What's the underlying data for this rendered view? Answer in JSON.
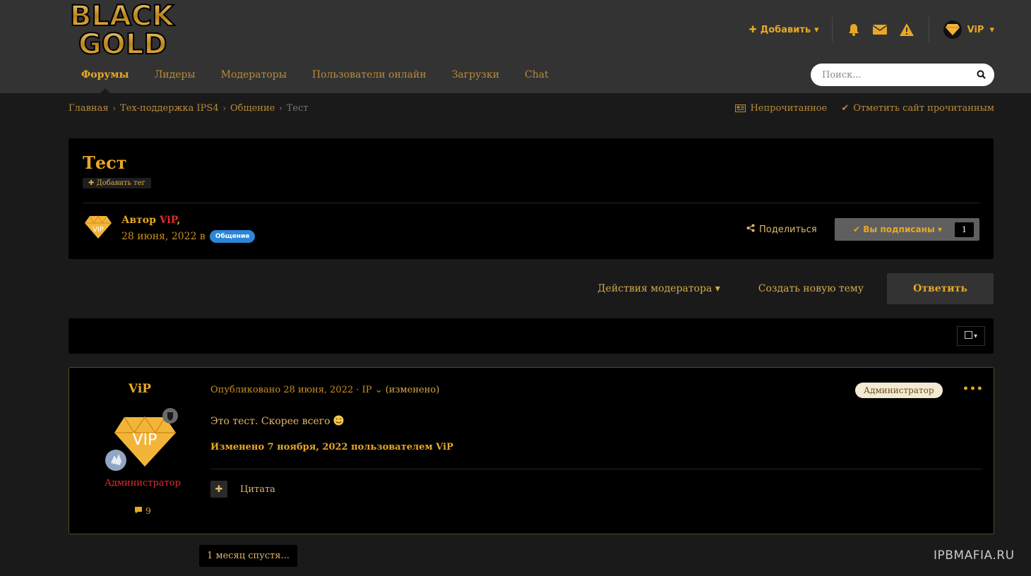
{
  "logo": {
    "line1": "BLACK",
    "line2": "GOLD"
  },
  "userbar": {
    "add_label": "Добавить",
    "icons": [
      "bell-icon",
      "envelope-icon",
      "warning-icon"
    ],
    "username": "ViP"
  },
  "nav": {
    "items": [
      {
        "label": "Форумы",
        "active": true
      },
      {
        "label": "Лидеры"
      },
      {
        "label": "Модераторы"
      },
      {
        "label": "Пользователи онлайн"
      },
      {
        "label": "Загрузки"
      },
      {
        "label": "Chat"
      }
    ],
    "search_placeholder": "Поиск..."
  },
  "breadcrumb": {
    "items": [
      "Главная",
      "Тех-поддержка IPS4",
      "Общение",
      "Тест"
    ],
    "unread": "Непрочитанное",
    "mark_read": "Отметить сайт прочитанным"
  },
  "topic": {
    "title": "Тест",
    "add_tag": "Добавить тег",
    "author_prefix": "Автор",
    "author_name": "ViP",
    "date": "28 июня, 2022 в",
    "forum_badge": "Общение",
    "share": "Поделиться",
    "follow_label": "Вы подписаны",
    "follow_count": "1"
  },
  "actions": {
    "moderator": "Действия модератора",
    "new_topic": "Создать новую тему",
    "reply": "Ответить"
  },
  "post": {
    "author": "ViP",
    "avatar_text": "VIP",
    "role": "Администратор",
    "posts_count": "9",
    "meta_prefix": "Опубликовано",
    "meta_date": "28 июня, 2022",
    "meta_ip": "· IP",
    "meta_edited": "(изменено)",
    "badge": "Администратор",
    "body": "Это тест. Скорее всего",
    "edit_note": "Изменено 7 ноября, 2022 пользователем ViP",
    "quote": "Цитата"
  },
  "time_gap": "1 месяц спустя...",
  "watermark": "IPBMAFIA.RU",
  "colors": {
    "accent": "#e7a824",
    "header": "#333333",
    "content_bg": "#000000",
    "page_bg": "#1a1a1a",
    "badge_blue": "#2b86d6",
    "role_red": "#e32b2b"
  }
}
